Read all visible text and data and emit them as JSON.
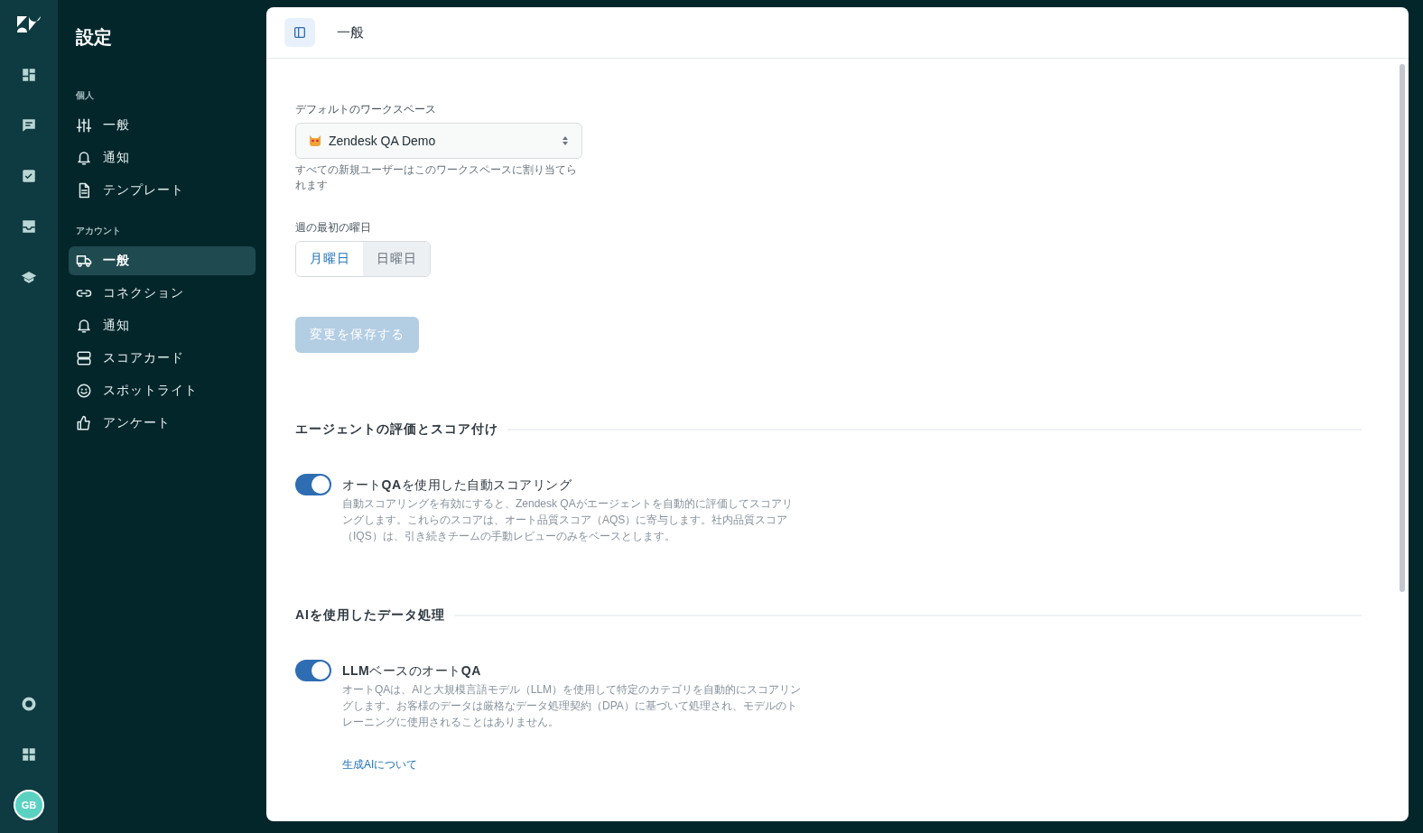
{
  "rail": {
    "avatar": "GB"
  },
  "sidebar": {
    "title": "設定",
    "sections": [
      {
        "heading": "個人",
        "items": [
          {
            "label": "一般",
            "selected": false
          },
          {
            "label": "通知",
            "selected": false
          },
          {
            "label": "テンプレート",
            "selected": false
          }
        ]
      },
      {
        "heading": "アカウント",
        "items": [
          {
            "label": "一般",
            "selected": true
          },
          {
            "label": "コネクション",
            "selected": false
          },
          {
            "label": "通知",
            "selected": false
          },
          {
            "label": "スコアカード",
            "selected": false
          },
          {
            "label": "スポットライト",
            "selected": false
          },
          {
            "label": "アンケート",
            "selected": false
          }
        ]
      }
    ]
  },
  "header": {
    "title": "一般"
  },
  "workspace": {
    "label": "デフォルトのワークスペース",
    "value": "Zendesk QA Demo",
    "hint": "すべての新規ユーザーはこのワークスペースに割り当てられます"
  },
  "week_start": {
    "label": "週の最初の曜日",
    "options": [
      {
        "label": "月曜日",
        "selected": true
      },
      {
        "label": "日曜日",
        "selected": false
      }
    ]
  },
  "save_button": {
    "label": "変更を保存する",
    "disabled": true
  },
  "sections": [
    {
      "title": "エージェントの評価とスコア付け",
      "toggles": [
        {
          "label": "オート**QA**を使用した自動スコアリング",
          "on": true,
          "description": "自動スコアリングを有効にすると、Zendesk QAがエージェントを自動的に評価してスコアリングします。これらのスコアは、オート品質スコア（AQS）に寄与します。社内品質スコア（IQS）は、引き続きチームの手動レビューのみをベースとします。"
        }
      ]
    },
    {
      "title": "AIを使用したデータ処理",
      "toggles": [
        {
          "label": "**LLM**ベースのオート**QA**",
          "on": true,
          "description": "オートQAは、AIと大規模言語モデル（LLM）を使用して特定のカテゴリを自動的にスコアリングします。お客様のデータは厳格なデータ処理契約（DPA）に基づいて処理され、モデルのトレーニングに使用されることはありません。",
          "link": "生成AIについて"
        }
      ]
    }
  ]
}
